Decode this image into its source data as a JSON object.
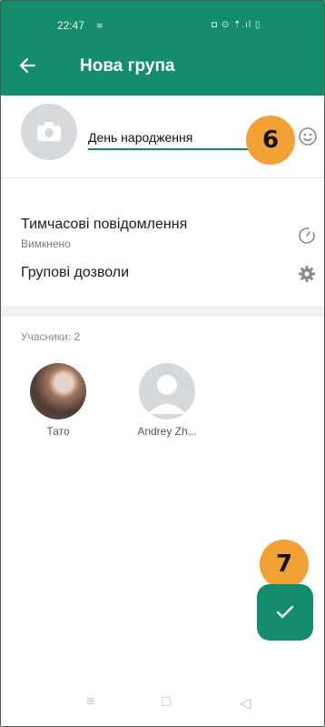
{
  "status_bar": {
    "time": "22:47",
    "time_extra": "≋",
    "icons": "◘ ⊙ ⇡.ıl ▯"
  },
  "header": {
    "title": "Нова група",
    "back_icon": "arrow-left"
  },
  "group": {
    "name": "День народження",
    "badge_step_name": "6"
  },
  "settings": [
    {
      "title": "Тимчасові повідомлення",
      "subtitle": "Вимкнено"
    },
    {
      "title": "Групові дозволи"
    }
  ],
  "members": {
    "label": "Учасники: 2",
    "items": [
      {
        "name": "Тато"
      },
      {
        "name": "Andrey Zh..."
      }
    ]
  },
  "fab": {
    "badge_step": "7"
  },
  "colors": {
    "primary": "#128c6a",
    "badge": "#f2a134"
  }
}
